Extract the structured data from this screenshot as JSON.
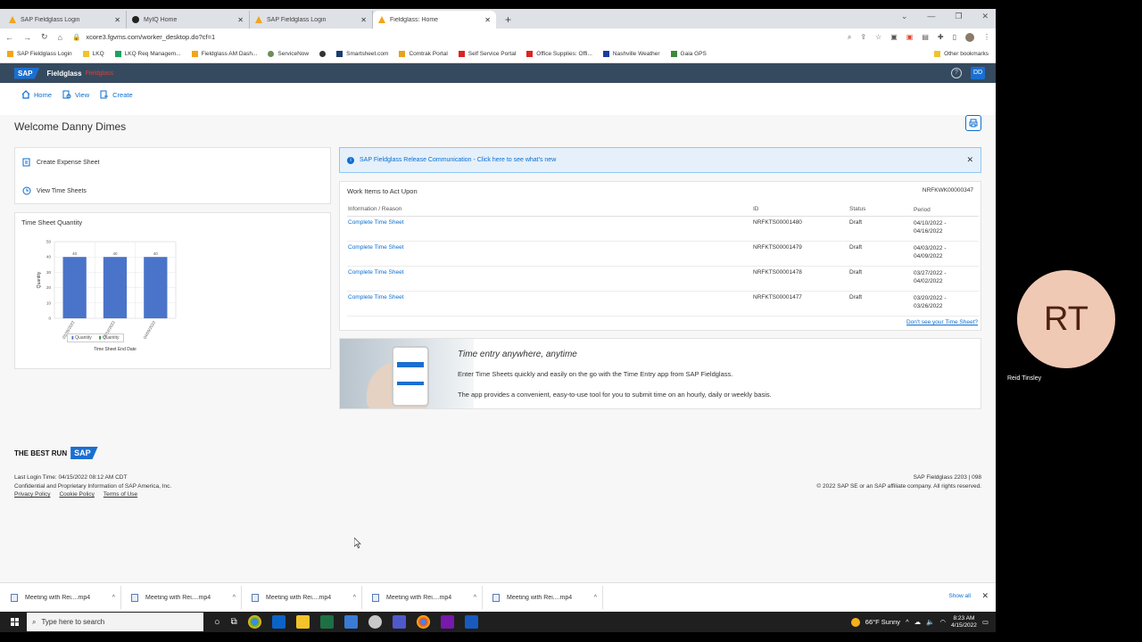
{
  "browser": {
    "tabs": [
      {
        "label": "SAP Fieldglass Login",
        "color": "#f2a51a"
      },
      {
        "label": "MyIQ Home",
        "color": "#222"
      },
      {
        "label": "SAP Fieldglass Login",
        "color": "#f2a51a"
      },
      {
        "label": "Fieldglass: Home",
        "color": "#f2a51a",
        "active": true
      }
    ],
    "new_tab": "+",
    "url": "xcore3.fgvms.com/worker_desktop.do?cf=1",
    "bookmarks": [
      {
        "label": "SAP Fieldglass Login",
        "color": "#f2a51a"
      },
      {
        "label": "LKQ",
        "color": "#f2c32a"
      },
      {
        "label": "LKQ Req Managem...",
        "color": "#1aa260"
      },
      {
        "label": "Fieldglass AM Dash...",
        "color": "#f2a51a"
      },
      {
        "label": "ServiceNow",
        "color": "#6b8e5a"
      },
      {
        "label": "",
        "color": "#333"
      },
      {
        "label": "Smartsheet.com",
        "color": "#1a3c6e"
      },
      {
        "label": "Comtrak Portal",
        "color": "#e8a21a"
      },
      {
        "label": "Self Service Portal",
        "color": "#d22"
      },
      {
        "label": "Office Supplies: Offi...",
        "color": "#d22"
      },
      {
        "label": "Nashville Weather",
        "color": "#1a3c9e"
      },
      {
        "label": "Gaia GPS",
        "color": "#3a8a3a"
      }
    ],
    "other_bookmarks": "Other bookmarks"
  },
  "sap": {
    "logo": "SAP",
    "product": "Fieldglass",
    "product_sub": "Fieldglass",
    "help": "?",
    "user_initials": "DD",
    "nav": {
      "home": "Home",
      "view": "View",
      "create": "Create"
    },
    "welcome": "Welcome Danny Dimes",
    "links": {
      "expense": "Create Expense Sheet",
      "timesheets": "View Time Sheets"
    },
    "notification": "SAP Fieldglass Release Communication - Click here to see what's new",
    "work": {
      "title": "Work Items to Act Upon",
      "worker_id": "NRFKWK00000347",
      "headers": [
        "Information / Reason",
        "ID",
        "Status",
        "Period"
      ],
      "rows": [
        {
          "info": "Complete Time Sheet",
          "id": "NRFKTS00001480",
          "status": "Draft",
          "period1": "04/10/2022 -",
          "period2": "04/16/2022"
        },
        {
          "info": "Complete Time Sheet",
          "id": "NRFKTS00001479",
          "status": "Draft",
          "period1": "04/03/2022 -",
          "period2": "04/09/2022"
        },
        {
          "info": "Complete Time Sheet",
          "id": "NRFKTS00001478",
          "status": "Draft",
          "period1": "03/27/2022 -",
          "period2": "04/02/2022"
        },
        {
          "info": "Complete Time Sheet",
          "id": "NRFKTS00001477",
          "status": "Draft",
          "period1": "03/20/2022 -",
          "period2": "03/26/2022"
        }
      ],
      "dont_see": "Don't see your Time Sheet?"
    },
    "promo": {
      "title": "Time entry anywhere, anytime",
      "line1": "Enter Time Sheets quickly and easily on the go with the Time Entry app from SAP Fieldglass.",
      "line2": "The app provides a convenient, easy-to-use tool for you to submit time on an hourly, daily or weekly basis."
    },
    "footer": {
      "best_run": "THE BEST RUN",
      "last_login": "Last Login Time: 04/15/2022 08:12 AM CDT",
      "confidential": "Confidential and Proprietary Information of SAP America, Inc.",
      "links": [
        "Privacy Policy",
        "Cookie Policy",
        "Terms of Use"
      ],
      "version": "SAP Fieldglass 2203 | 098",
      "copyright": "© 2022 SAP SE or an SAP affiliate company. All rights reserved."
    }
  },
  "chart_data": {
    "type": "bar",
    "title": "Time Sheet Quantity",
    "categories": [
      "03/26/2022",
      "04/02/2022",
      "04/09/2022"
    ],
    "series": [
      {
        "name": "Quantity",
        "values": [
          40,
          40,
          40
        ]
      }
    ],
    "data_labels": [
      "40",
      "40",
      "40"
    ],
    "xlabel": "Time Sheet End Date",
    "ylabel": "Quantity",
    "ylim": [
      0,
      50
    ],
    "yticks": [
      0,
      10,
      20,
      30,
      40,
      50
    ],
    "legend": [
      "Quantity",
      "Quantity"
    ],
    "bar_color": "#4a74c9"
  },
  "downloads": {
    "items": [
      "Meeting with Rei....mp4",
      "Meeting with Rei....mp4",
      "Meeting with Rei....mp4",
      "Meeting with Rei....mp4",
      "Meeting with Rei....mp4"
    ],
    "show_all": "Show all"
  },
  "taskbar": {
    "search_placeholder": "Type here to search",
    "weather": "66°F  Sunny",
    "time": "8:23 AM",
    "date": "4/15/2022"
  },
  "participant": {
    "initials": "RT",
    "name": "Reid Tinsley"
  }
}
